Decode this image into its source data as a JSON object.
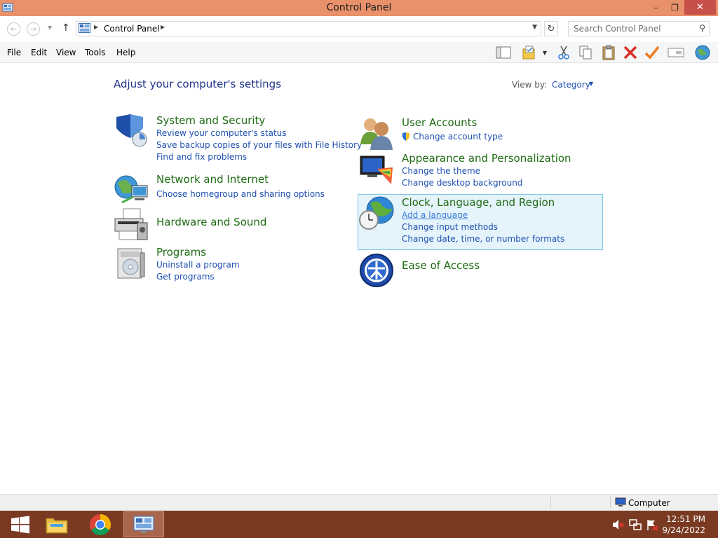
{
  "window": {
    "title": "Control Panel",
    "minimize": "–",
    "restore": "❐",
    "close": "✕"
  },
  "address": {
    "breadcrumb": "Control Panel",
    "search_placeholder": "Search Control Panel"
  },
  "menu": {
    "items": [
      "File",
      "Edit",
      "View",
      "Tools",
      "Help"
    ]
  },
  "toolbar_icons": [
    "layout-icon",
    "folder-options-icon",
    "cut-icon",
    "copy-icon",
    "paste-icon",
    "delete-icon",
    "check-icon",
    "rename-icon",
    "network-globe-icon"
  ],
  "content": {
    "heading": "Adjust your computer's settings",
    "view_by_label": "View by:",
    "view_by_value": "Category",
    "left": [
      {
        "title": "System and Security",
        "icon": "security-shield-icon",
        "links": [
          "Review your computer's status",
          "Save backup copies of your files with File History",
          "Find and fix problems"
        ]
      },
      {
        "title": "Network and Internet",
        "icon": "network-globe-icon",
        "links": [
          "Choose homegroup and sharing options"
        ]
      },
      {
        "title": "Hardware and Sound",
        "icon": "printer-icon",
        "links": []
      },
      {
        "title": "Programs",
        "icon": "programs-icon",
        "links": [
          "Uninstall a program",
          "Get programs"
        ]
      }
    ],
    "right": [
      {
        "title": "User Accounts",
        "icon": "users-icon",
        "links": [
          "Change account type"
        ]
      },
      {
        "title": "Appearance and Personalization",
        "icon": "appearance-icon",
        "links": [
          "Change the theme",
          "Change desktop background"
        ]
      },
      {
        "title": "Clock, Language, and Region",
        "icon": "clock-globe-icon",
        "links": [
          "Add a language",
          "Change input methods",
          "Change date, time, or number formats"
        ]
      },
      {
        "title": "Ease of Access",
        "icon": "ease-of-access-icon",
        "links": []
      }
    ]
  },
  "statusbar": {
    "location": "Computer"
  },
  "taskbar": {
    "time": "12:51 PM",
    "date": "9/24/2022"
  },
  "colors": {
    "titlebar": "#e8916a",
    "taskbar": "#7a3a22",
    "category_title": "#1f6b14",
    "link": "#1e4fb0",
    "heading": "#1e3287"
  }
}
